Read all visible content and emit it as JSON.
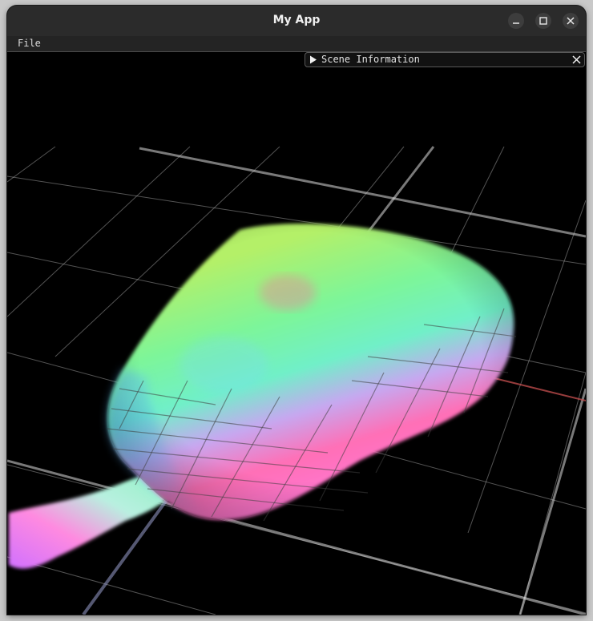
{
  "window": {
    "title": "My App"
  },
  "menu": {
    "file": "File"
  },
  "scene_panel": {
    "title": "Scene Information",
    "collapsed": true
  },
  "colors": {
    "background": "#000000",
    "grid": "#ffffff",
    "axis_x": "#c85050",
    "titlebar": "#2b2b2b"
  },
  "icons": {
    "minimize": "minimize-icon",
    "maximize": "maximize-icon",
    "close": "close-icon",
    "expand": "triangle-right-icon"
  }
}
